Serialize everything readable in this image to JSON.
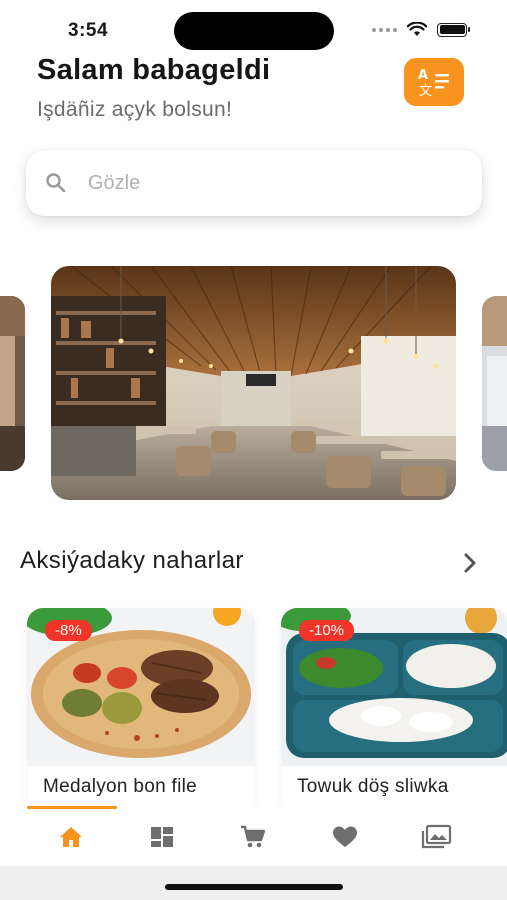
{
  "status_bar": {
    "time": "3:54"
  },
  "header": {
    "greeting": "Salam babageldi",
    "subtitle": "Işdäñiz açyk bolsun!",
    "language_icon": "translate-icon"
  },
  "search": {
    "placeholder": "Gözle",
    "value": "",
    "icon": "search-icon"
  },
  "carousel": {
    "slides": [
      "restaurant-interior-left",
      "restaurant-interior-main",
      "restaurant-interior-right"
    ]
  },
  "section": {
    "title": "Aksiýadaky naharlar",
    "arrow_icon": "chevron-right-icon"
  },
  "products": [
    {
      "name": "Medalyon bon file",
      "discount": "-8%"
    },
    {
      "name": "Towuk döş sliwka",
      "discount": "-10%"
    }
  ],
  "tabbar": {
    "active": "home",
    "tabs": [
      "home-icon",
      "dashboard-icon",
      "cart-icon",
      "heart-icon",
      "gallery-icon"
    ]
  },
  "colors": {
    "accent": "#f7931e",
    "discount": "#f0342a"
  }
}
